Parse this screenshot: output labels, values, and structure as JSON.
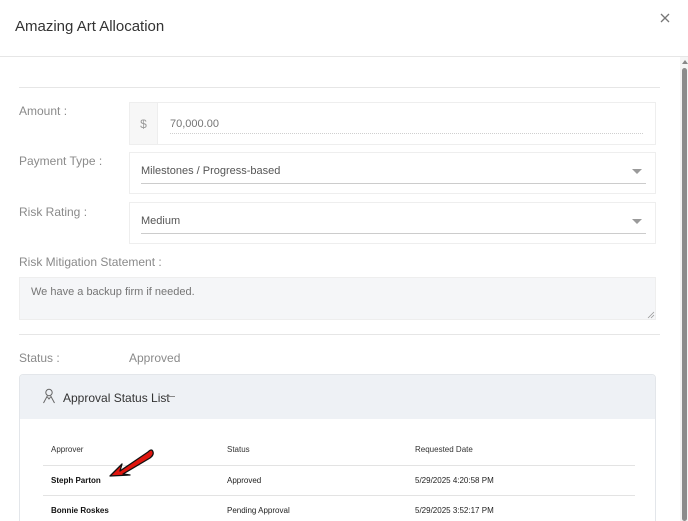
{
  "modal": {
    "title": "Amazing Art Allocation"
  },
  "fields": {
    "amount": {
      "label": "Amount :",
      "currency": "$",
      "placeholder": "70,000.00"
    },
    "payment_type": {
      "label": "Payment Type :",
      "value": "Milestones / Progress-based"
    },
    "risk_rating": {
      "label": "Risk Rating :",
      "value": "Medium"
    },
    "risk_mitigation": {
      "label": "Risk Mitigation Statement :",
      "placeholder": "We have a backup firm if needed."
    }
  },
  "status": {
    "label": "Status :",
    "value": "Approved"
  },
  "approval_panel": {
    "title": "Approval Status List",
    "columns": [
      "Approver",
      "Status",
      "Requested Date"
    ],
    "rows": [
      {
        "approver": "Steph Parton",
        "status": "Approved",
        "requested_date": "5/29/2025 4:20:58 PM"
      },
      {
        "approver": "Bonnie Roskes",
        "status": "Pending Approval",
        "requested_date": "5/29/2025 3:52:17 PM"
      }
    ]
  },
  "colors": {
    "annotation_arrow": "#e0160f",
    "panel_header": "#eef1f5"
  },
  "icons": {
    "close": "close-icon",
    "approver": "user-icon",
    "collapse": "minus-icon"
  }
}
